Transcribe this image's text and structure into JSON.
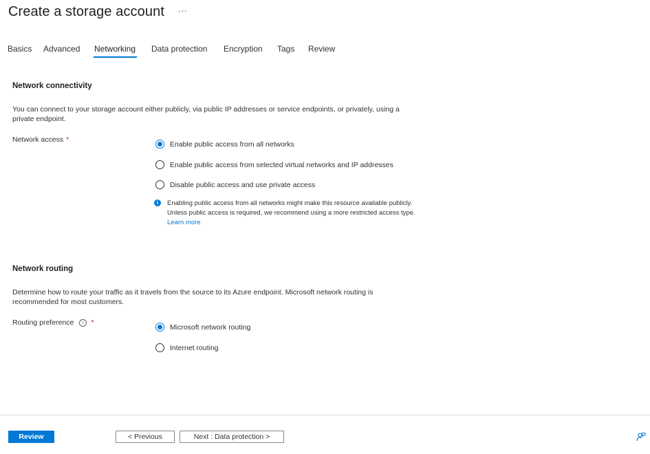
{
  "header": {
    "title": "Create a storage account",
    "more_label": "···"
  },
  "tabs": [
    {
      "label": "Basics"
    },
    {
      "label": "Advanced"
    },
    {
      "label": "Networking",
      "active": true
    },
    {
      "label": "Data protection"
    },
    {
      "label": "Encryption"
    },
    {
      "label": "Tags"
    },
    {
      "label": "Review"
    }
  ],
  "connectivity": {
    "heading": "Network connectivity",
    "description": "You can connect to your storage account either publicly, via public IP addresses or service endpoints, or privately, using a private endpoint.",
    "field_label": "Network access",
    "required_mark": "*",
    "options": [
      {
        "label": "Enable public access from all networks",
        "checked": true
      },
      {
        "label": "Enable public access from selected virtual networks and IP addresses",
        "checked": false
      },
      {
        "label": "Disable public access and use private access",
        "checked": false
      }
    ],
    "info_icon": "i",
    "info_text": "Enabling public access from all networks might make this resource available publicly. Unless public access is required, we recommend using a more restricted access type.",
    "info_link": "Learn more"
  },
  "routing": {
    "heading": "Network routing",
    "description": "Determine how to route your traffic as it travels from the source to its Azure endpoint. Microsoft network routing is recommended for most customers.",
    "field_label": "Routing preference",
    "info_icon": "i",
    "required_mark": "*",
    "options": [
      {
        "label": "Microsoft network routing",
        "checked": true
      },
      {
        "label": "Internet routing",
        "checked": false
      }
    ]
  },
  "footer": {
    "review_label": "Review",
    "previous_label": "< Previous",
    "next_label": "Next : Data protection >",
    "feedback_icon": "feedback-icon"
  },
  "colors": {
    "accent": "#0078d4",
    "required": "#a4262c",
    "text": "#323130"
  }
}
